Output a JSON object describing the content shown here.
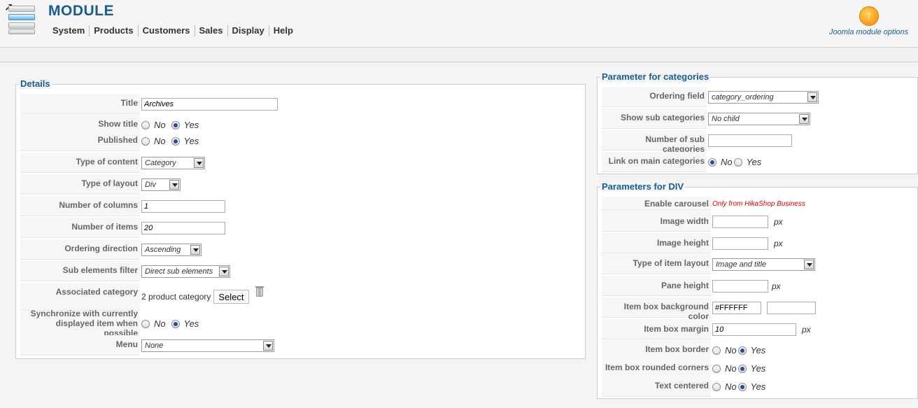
{
  "header": {
    "title": "MODULE",
    "menu": [
      "System",
      "Products",
      "Customers",
      "Sales",
      "Display",
      "Help"
    ],
    "options_label": "Joomla module options"
  },
  "details": {
    "legend": "Details",
    "title_label": "Title",
    "title_value": "Archives",
    "show_title_label": "Show title",
    "published_label": "Published",
    "no": "No",
    "yes": "Yes",
    "type_content_label": "Type of content",
    "type_content_value": "Category",
    "type_layout_label": "Type of layout",
    "type_layout_value": "Div",
    "num_columns_label": "Number of columns",
    "num_columns_value": "1",
    "num_items_label": "Number of items",
    "num_items_value": "20",
    "ordering_dir_label": "Ordering direction",
    "ordering_dir_value": "Ascending",
    "sub_filter_label": "Sub elements filter",
    "sub_filter_value": "Direct sub elements",
    "assoc_cat_label": "Associated category",
    "assoc_cat_value": "2 product category",
    "select_label": "Select",
    "sync_label_1": "Synchronize with currently",
    "sync_label_2": "displayed item when possible",
    "menu_label": "Menu",
    "menu_value": "None"
  },
  "categories": {
    "legend": "Parameter for categories",
    "ordering_label": "Ordering field",
    "ordering_value": "category_ordering",
    "show_sub_label": "Show sub categories",
    "show_sub_value": "No child",
    "num_sub_label": "Number of sub categories",
    "num_sub_value": "",
    "link_main_label": "Link on main categories"
  },
  "div": {
    "legend": "Parameters for DIV",
    "carousel_label": "Enable carousel",
    "carousel_value": "Only from HikaShop Business",
    "img_width_label": "Image width",
    "img_height_label": "Image height",
    "px": "px",
    "item_layout_label": "Type of item layout",
    "item_layout_value": "Image and title",
    "pane_height_label": "Pane height",
    "bg_color_label": "Item box background color",
    "bg_color_value": "#FFFFFF",
    "margin_label": "Item box margin",
    "margin_value": "10",
    "border_label": "Item box border",
    "rounded_label": "Item box rounded corners",
    "centered_label": "Text centered"
  }
}
